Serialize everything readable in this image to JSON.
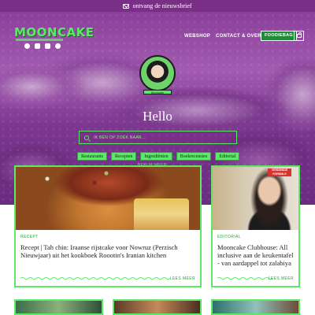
{
  "topbar": {
    "text": "ontvang de nieuwsbrief",
    "icon": "envelope-icon"
  },
  "header": {
    "logo": "MOONCAKE",
    "avatar_caption": "Mooncake",
    "socials": [
      "facebook-icon",
      "instagram-icon",
      "youtube-icon",
      "spotify-icon"
    ],
    "nav": {
      "webshop": "WEBSHOP",
      "contact": "CONTACT & OVER",
      "foodie": "FOODIEBAG",
      "cart_icon": "shopping-bag-icon"
    }
  },
  "hero": {
    "greeting": "Hello",
    "search_placeholder": "IK BEN OP ZOEK NAAR...",
    "chips": [
      "Restaurants",
      "Recepten",
      "Ingrediënten",
      "Boekrecensies",
      "Editorial"
    ],
    "more_link": "BEKIJK MEER"
  },
  "cards": [
    {
      "category": "RECEPT",
      "title": "Recept | Tah chin: Iraanse rijstcake voor Nowruz (Perzisch Nieuwjaar) uit het kookboek Roootin's Iranian kitchen",
      "read_more": "LEES MEER"
    },
    {
      "category": "EDITORIAL",
      "badge": "VERDIENDE FORMULE",
      "title": "Mooncake Clubhouse: All inclusive aan de keukentafel - van aardappel tot zalabiya",
      "read_more": "LEES MEER"
    }
  ],
  "colors": {
    "accent": "#5ee86a",
    "purple": "#7a2f86",
    "dark_green": "#2f9e3e"
  }
}
